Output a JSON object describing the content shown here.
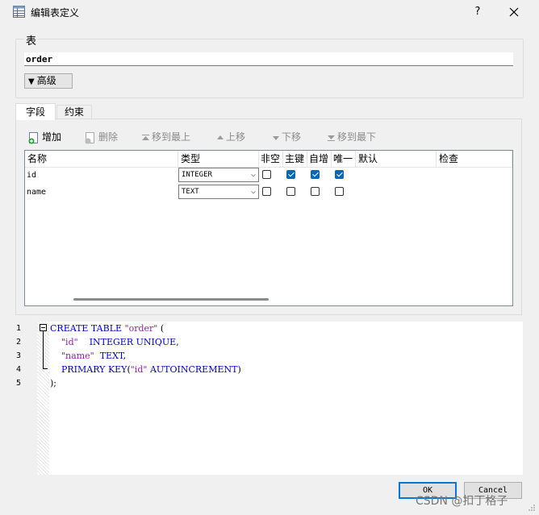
{
  "window": {
    "title": "编辑表定义",
    "help": "?"
  },
  "table_group": {
    "label": "表",
    "name_value": "order",
    "advanced_button": "高级"
  },
  "tabs": [
    {
      "label": "字段"
    },
    {
      "label": "约束"
    }
  ],
  "toolbar": {
    "add": "增加",
    "delete": "删除",
    "move_top": "移到最上",
    "move_up": "上移",
    "move_down": "下移",
    "move_bottom": "移到最下"
  },
  "grid": {
    "columns": [
      "名称",
      "类型",
      "非空",
      "主键",
      "自增",
      "唯一",
      "默认",
      "检查"
    ],
    "rows": [
      {
        "name": "id",
        "type": "INTEGER",
        "not_null": false,
        "primary_key": true,
        "autoincrement": true,
        "unique": true,
        "default": "",
        "check": ""
      },
      {
        "name": "name",
        "type": "TEXT",
        "not_null": false,
        "primary_key": false,
        "autoincrement": false,
        "unique": false,
        "default": "",
        "check": ""
      }
    ]
  },
  "sql": {
    "line_numbers": [
      "1",
      "2",
      "3",
      "4",
      "5"
    ],
    "lines": [
      [
        {
          "t": "kw",
          "v": "CREATE TABLE "
        },
        {
          "t": "str",
          "v": "\"order\""
        },
        {
          "t": "txt",
          "v": " ("
        }
      ],
      [
        {
          "t": "txt",
          "v": "    "
        },
        {
          "t": "str",
          "v": "\"id\""
        },
        {
          "t": "txt",
          "v": "    "
        },
        {
          "t": "kw",
          "v": "INTEGER UNIQUE"
        },
        {
          "t": "txt",
          "v": ","
        }
      ],
      [
        {
          "t": "txt",
          "v": "    "
        },
        {
          "t": "str",
          "v": "\"name\""
        },
        {
          "t": "txt",
          "v": "  "
        },
        {
          "t": "kw",
          "v": "TEXT"
        },
        {
          "t": "txt",
          "v": ","
        }
      ],
      [
        {
          "t": "txt",
          "v": "    "
        },
        {
          "t": "kw",
          "v": "PRIMARY KEY"
        },
        {
          "t": "txt",
          "v": "("
        },
        {
          "t": "str",
          "v": "\"id\""
        },
        {
          "t": "txt",
          "v": " "
        },
        {
          "t": "kw",
          "v": "AUTOINCREMENT"
        },
        {
          "t": "txt",
          "v": ")"
        }
      ],
      [
        {
          "t": "txt",
          "v": ");"
        }
      ]
    ]
  },
  "buttons": {
    "ok": "OK",
    "cancel": "Cancel"
  },
  "watermark": "CSDN @扣丁格子",
  "colors": {
    "keyword": "#0000c0",
    "string": "#8b1fa8",
    "checkbox_checked": "#0067c0",
    "ok_border": "#0078d7"
  }
}
